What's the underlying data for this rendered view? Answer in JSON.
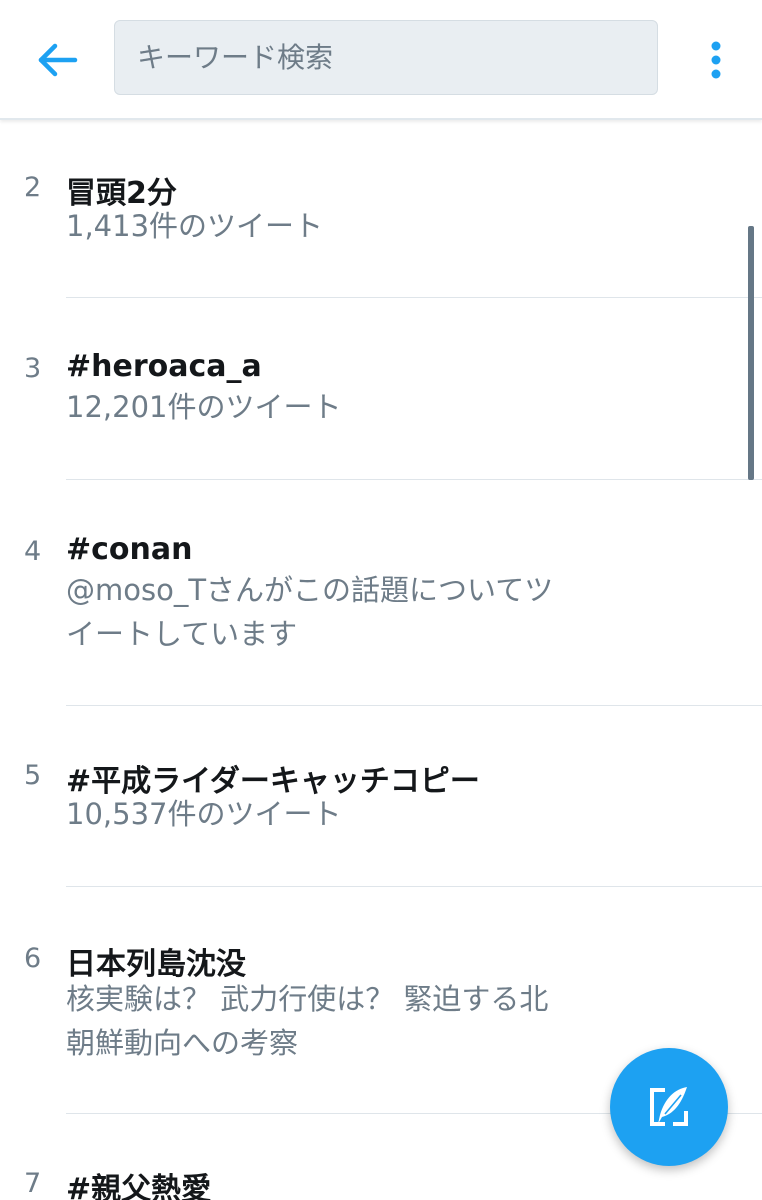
{
  "header": {
    "search_placeholder": "キーワード検索",
    "back_icon": "arrow-left-icon",
    "menu_icon": "vertical-dots-icon"
  },
  "trends": [
    {
      "rank": "2",
      "name": "冒頭2分",
      "meta_lines": [
        "1,413件のツイート"
      ]
    },
    {
      "rank": "3",
      "name": "#heroaca_a",
      "meta_lines": [
        "12,201件のツイート"
      ]
    },
    {
      "rank": "4",
      "name": "#conan",
      "meta_lines": [
        "@moso_Tさんがこの話題についてツ",
        "イートしています"
      ]
    },
    {
      "rank": "5",
      "name": "#平成ライダーキャッチコピー",
      "meta_lines": [
        "10,537件のツイート"
      ]
    },
    {
      "rank": "6",
      "name": "日本列島沈没",
      "meta_lines": [
        "核実験は？ 武力行使は？ 緊迫する北",
        "朝鮮動向への考察"
      ]
    },
    {
      "rank": "7",
      "name": "#親父熱愛",
      "meta_lines": []
    }
  ],
  "fab": {
    "icon": "compose-tweet-icon"
  },
  "colors": {
    "accent": "#1da1f2",
    "text_primary": "#14171a",
    "text_secondary": "#6e7c88",
    "divider": "#dfe5ea"
  }
}
